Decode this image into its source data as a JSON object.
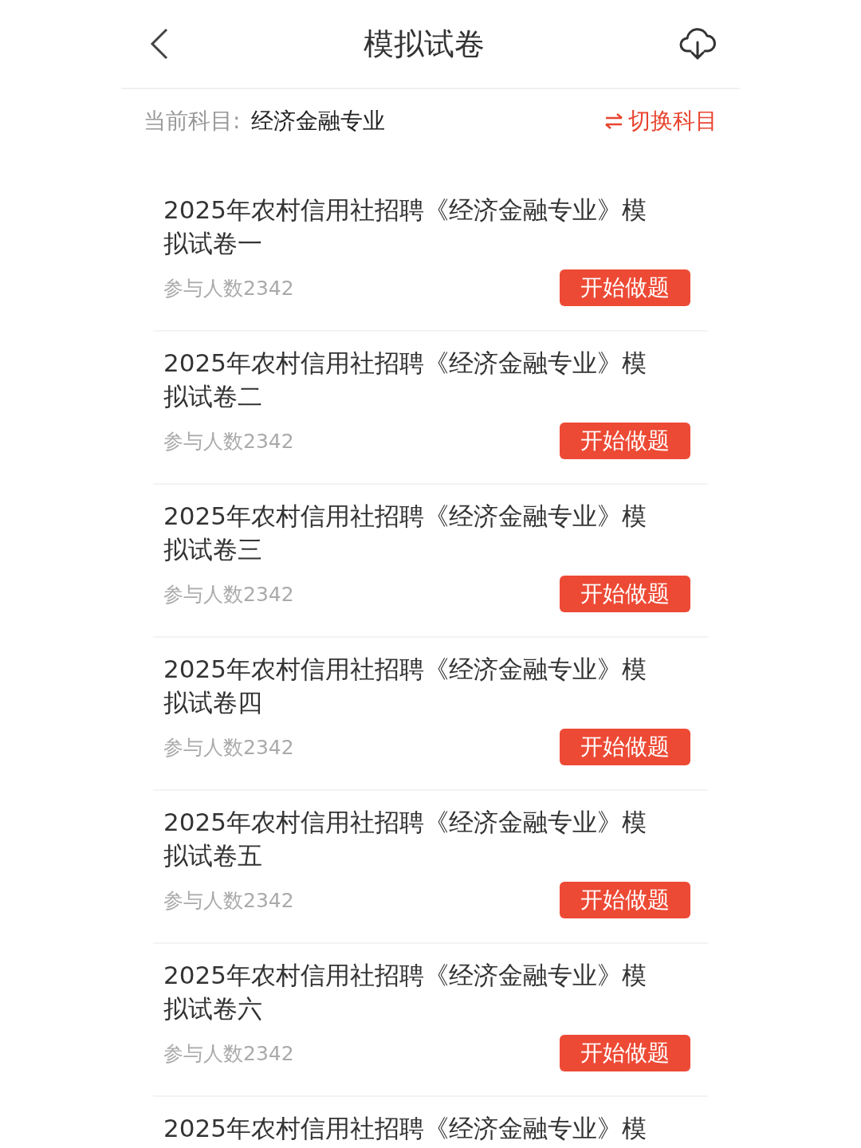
{
  "header": {
    "title": "模拟试卷"
  },
  "subject": {
    "label": "当前科目:",
    "value": "经济金融专业",
    "switch_label": "切换科目"
  },
  "papers": [
    {
      "title": "2025年农村信用社招聘《经济金融专业》模拟试卷一",
      "participants": "参与人数2342",
      "button": "开始做题"
    },
    {
      "title": "2025年农村信用社招聘《经济金融专业》模拟试卷二",
      "participants": "参与人数2342",
      "button": "开始做题"
    },
    {
      "title": "2025年农村信用社招聘《经济金融专业》模拟试卷三",
      "participants": "参与人数2342",
      "button": "开始做题"
    },
    {
      "title": "2025年农村信用社招聘《经济金融专业》模拟试卷四",
      "participants": "参与人数2342",
      "button": "开始做题"
    },
    {
      "title": "2025年农村信用社招聘《经济金融专业》模拟试卷五",
      "participants": "参与人数2342",
      "button": "开始做题"
    },
    {
      "title": "2025年农村信用社招聘《经济金融专业》模拟试卷六",
      "participants": "参与人数2342",
      "button": "开始做题"
    },
    {
      "title": "2025年农村信用社招聘《经济金融专业》模"
    }
  ]
}
